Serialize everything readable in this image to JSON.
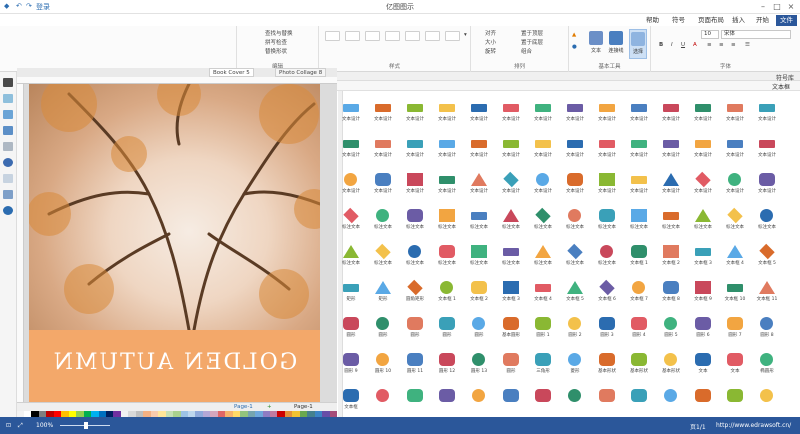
{
  "window": {
    "title": "亿图图示",
    "quick_access": "登录"
  },
  "tabs": [
    "文件",
    "开始",
    "插入",
    "页面布局",
    "符号",
    "帮助"
  ],
  "ribbon": {
    "groups": [
      "文件",
      "字体",
      "基本工具",
      "排列",
      "样式",
      "编辑"
    ],
    "font_name": "宋体",
    "font_size": "10",
    "tools": {
      "select": "选择",
      "connector": "连接线",
      "text": "文本"
    },
    "arrange_items": [
      "置于顶层",
      "置于底层",
      "组合",
      "对齐",
      "大小",
      "旋转"
    ],
    "edit_items": [
      "查找与替换",
      "拼写检查",
      "替换形状"
    ],
    "style_label": "Abc"
  },
  "doc_tabs": [
    "Book Cover 5",
    "Photo Collage 8"
  ],
  "canvas": {
    "title": "GOLDEN AUTUMN"
  },
  "library": {
    "panel_title": "符号库",
    "category": "文本框",
    "rows": [
      [
        "文本设计",
        "文本设计",
        "文本设计",
        "文本设计",
        "文本设计",
        "文本设计",
        "文本设计",
        "文本设计",
        "文本设计",
        "文本设计",
        "文本设计",
        "文本设计",
        "文本设计",
        "文本设计"
      ],
      [
        "文本设计",
        "文本设计",
        "文本设计",
        "文本设计",
        "文本设计",
        "文本设计",
        "文本设计",
        "文本设计",
        "文本设计",
        "文本设计",
        "文本设计",
        "文本设计",
        "文本设计",
        "文本设计"
      ],
      [
        "文本设计",
        "文本设计",
        "文本设计",
        "文本设计",
        "文本设计",
        "文本设计",
        "文本设计",
        "文本设计",
        "文本设计",
        "文本设计",
        "文本设计",
        "文本设计",
        "文本设计",
        "文本设计"
      ],
      [
        "标注文本",
        "标注文本",
        "标注文本",
        "标注文本",
        "标注文本",
        "标注文本",
        "标注文本",
        "标注文本",
        "标注文本",
        "标注文本",
        "标注文本",
        "标注文本",
        "标注文本",
        "标注文本"
      ],
      [
        "文本框 5",
        "文本框 4",
        "文本框 3",
        "文本框 2",
        "文本框 1",
        "标注文本",
        "标注文本",
        "标注文本",
        "标注文本",
        "标注文本",
        "标注文本",
        "标注文本",
        "标注文本",
        "标注文本"
      ],
      [
        "文本框 11",
        "文本框 10",
        "文本框 9",
        "文本框 8",
        "文本框 7",
        "文本框 6",
        "文本框 5",
        "文本框 4",
        "文本框 3",
        "文本框 2",
        "文本框 1",
        "圆角矩形",
        "矩形",
        "矩形"
      ],
      [
        "圆形 8",
        "圆形 7",
        "圆形 6",
        "圆形 5",
        "圆形 4",
        "圆形 3",
        "圆形 2",
        "圆形 1",
        "基本圆形",
        "圆形",
        "圆形",
        "圆形",
        "圆形",
        "圆形"
      ],
      [
        "椭圆形",
        "文本",
        "文本",
        "基本形状",
        "基本形状",
        "基本形状",
        "菱形",
        "三角形",
        "圆形",
        "圆形 13",
        "圆形 12",
        "圆形 11",
        "圆形 10",
        "圆形 9"
      ],
      [
        "",
        "",
        "",
        "",
        "",
        "",
        "",
        "",
        "",
        "",
        "",
        "",
        "",
        "文本框"
      ]
    ]
  },
  "page_tabs": [
    "Page-1",
    "Page-1"
  ],
  "status": {
    "url": "http://www.edrawsoft.cn/",
    "page": "页1/1",
    "zoom": "100%"
  },
  "colors": {
    "accent": "#2b579a",
    "swatches": [
      "#ffffff",
      "#000000",
      "#7f7f7f",
      "#c00000",
      "#ff0000",
      "#ffc000",
      "#ffff00",
      "#92d050",
      "#00b050",
      "#00b0f0",
      "#0070c0",
      "#002060",
      "#7030a0",
      "#f2f2f2",
      "#d9d9d9",
      "#bfbfbf",
      "#f4b183",
      "#f8cbad",
      "#ffe699",
      "#c5e0b4",
      "#a9d18e",
      "#9dc3e6",
      "#bdd7ee",
      "#8faadc",
      "#b4a7d6",
      "#d5a6bd",
      "#e06666",
      "#f6b26b",
      "#ffd966",
      "#93c47d",
      "#76a5af",
      "#6fa8dc",
      "#8e7cc3",
      "#c27ba0",
      "#cc0000",
      "#e69138",
      "#f1c232",
      "#6aa84f",
      "#45818e",
      "#3d85c6",
      "#674ea7",
      "#a64d79"
    ]
  }
}
